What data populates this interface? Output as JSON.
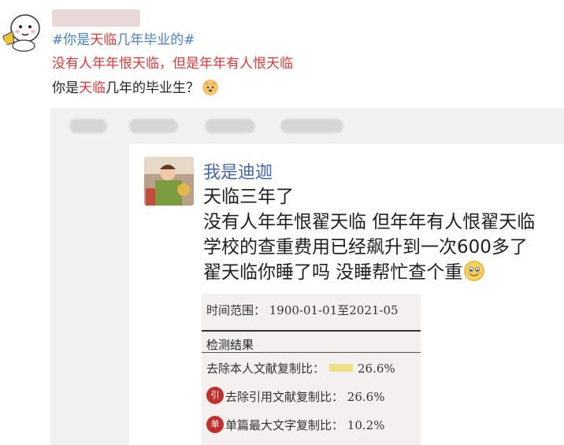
{
  "post": {
    "hashtag_prefix": "#你是",
    "hashtag_highlight": "天临",
    "hashtag_suffix": "几年毕业的#",
    "line2_part1": "没有人年年恨天临，但是",
    "line2_part2": "年年有人恨天临",
    "line3_part1": "你是",
    "line3_highlight": "天临",
    "line3_part2": "几年的毕业生？"
  },
  "quoted": {
    "author": "我是迪迦",
    "lines": [
      "天临三年了",
      "没有人年年恨翟天临 但年年有人恨翟天临",
      "学校的查重费用已经飙升到一次600多了",
      "翟天临你睡了吗 没睡帮忙查个重"
    ]
  },
  "report": {
    "range": "时间范围：  1900-01-01至2021-05",
    "heading": "检测结果",
    "row1_label": "去除本人文献复制比：",
    "row1_value": "26.6%",
    "row2_label": "去除引用文献复制比：",
    "row2_value": "26.6%",
    "row3_label": "单篇最大文字复制比：",
    "row3_value": "10.2%",
    "badge1": "引",
    "badge2": "单"
  },
  "icons": [
    "cartoon-avatar-icon",
    "doge-emoji-icon",
    "smile-emoji-icon"
  ],
  "colors": {
    "link": "#4a7fc4",
    "highlight": "#d83a3a",
    "author": "#4966a3"
  }
}
